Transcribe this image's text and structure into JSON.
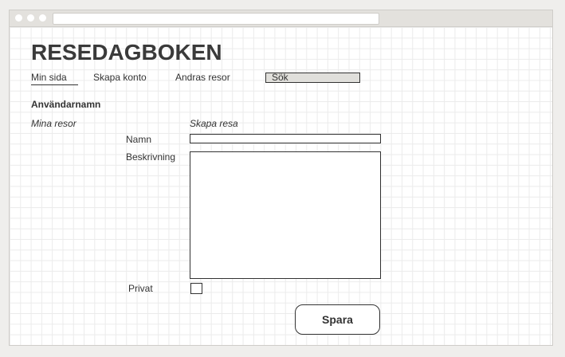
{
  "header": {
    "title": "RESEDAGBOKEN"
  },
  "nav": {
    "items": [
      {
        "label": "Min sida",
        "active": true
      },
      {
        "label": "Skapa konto"
      },
      {
        "label": "Andras resor"
      }
    ],
    "search_label": "Sök"
  },
  "user": {
    "name": "Användarnamn"
  },
  "left": {
    "heading": "Mina resor"
  },
  "form": {
    "heading": "Skapa resa",
    "name_label": "Namn",
    "name_value": "",
    "description_label": "Beskrivning",
    "description_value": "",
    "private_label": "Privat",
    "private_checked": false,
    "save_label": "Spara"
  }
}
